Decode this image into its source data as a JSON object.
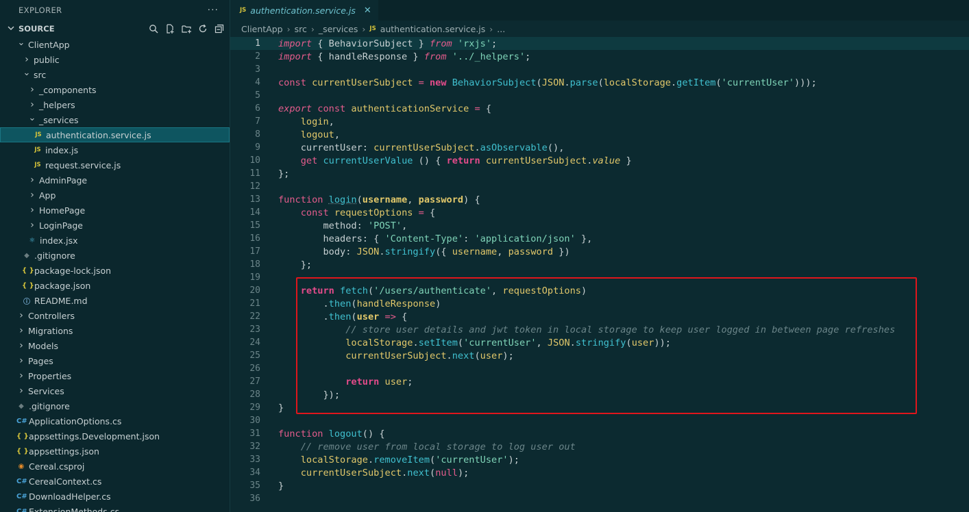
{
  "sidebar": {
    "title": "EXPLORER",
    "more": "···",
    "section": "SOURCE",
    "items": [
      {
        "label": "ClientApp",
        "depth": 1,
        "chev": "⌄",
        "icon": ""
      },
      {
        "label": "public",
        "depth": 2,
        "chev": "›",
        "icon": ""
      },
      {
        "label": "src",
        "depth": 2,
        "chev": "⌄",
        "icon": ""
      },
      {
        "label": "_components",
        "depth": 3,
        "chev": "›",
        "icon": ""
      },
      {
        "label": "_helpers",
        "depth": 3,
        "chev": "›",
        "icon": ""
      },
      {
        "label": "_services",
        "depth": 3,
        "chev": "⌄",
        "icon": ""
      },
      {
        "label": "authentication.service.js",
        "depth": 4,
        "chev": "",
        "icon": "JS",
        "selected": true
      },
      {
        "label": "index.js",
        "depth": 4,
        "chev": "",
        "icon": "JS"
      },
      {
        "label": "request.service.js",
        "depth": 4,
        "chev": "",
        "icon": "JS"
      },
      {
        "label": "AdminPage",
        "depth": 3,
        "chev": "›",
        "icon": ""
      },
      {
        "label": "App",
        "depth": 3,
        "chev": "›",
        "icon": ""
      },
      {
        "label": "HomePage",
        "depth": 3,
        "chev": "›",
        "icon": ""
      },
      {
        "label": "LoginPage",
        "depth": 3,
        "chev": "›",
        "icon": ""
      },
      {
        "label": "index.jsx",
        "depth": 3,
        "chev": "",
        "icon": "react"
      },
      {
        "label": ".gitignore",
        "depth": 2,
        "chev": "",
        "icon": "git"
      },
      {
        "label": "package-lock.json",
        "depth": 2,
        "chev": "",
        "icon": "{}"
      },
      {
        "label": "package.json",
        "depth": 2,
        "chev": "",
        "icon": "{}"
      },
      {
        "label": "README.md",
        "depth": 2,
        "chev": "",
        "icon": "info"
      },
      {
        "label": "Controllers",
        "depth": 1,
        "chev": "›",
        "icon": ""
      },
      {
        "label": "Migrations",
        "depth": 1,
        "chev": "›",
        "icon": ""
      },
      {
        "label": "Models",
        "depth": 1,
        "chev": "›",
        "icon": ""
      },
      {
        "label": "Pages",
        "depth": 1,
        "chev": "›",
        "icon": ""
      },
      {
        "label": "Properties",
        "depth": 1,
        "chev": "›",
        "icon": ""
      },
      {
        "label": "Services",
        "depth": 1,
        "chev": "›",
        "icon": ""
      },
      {
        "label": ".gitignore",
        "depth": 1,
        "chev": "",
        "icon": "git"
      },
      {
        "label": "ApplicationOptions.cs",
        "depth": 1,
        "chev": "",
        "icon": "C#"
      },
      {
        "label": "appsettings.Development.json",
        "depth": 1,
        "chev": "",
        "icon": "{}"
      },
      {
        "label": "appsettings.json",
        "depth": 1,
        "chev": "",
        "icon": "{}"
      },
      {
        "label": "Cereal.csproj",
        "depth": 1,
        "chev": "",
        "icon": "rss"
      },
      {
        "label": "CerealContext.cs",
        "depth": 1,
        "chev": "",
        "icon": "C#"
      },
      {
        "label": "DownloadHelper.cs",
        "depth": 1,
        "chev": "",
        "icon": "C#"
      },
      {
        "label": "ExtensionMethods.cs",
        "depth": 1,
        "chev": "",
        "icon": "C#"
      }
    ]
  },
  "tab": {
    "badge": "JS",
    "label": "authentication.service.js",
    "close": "✕"
  },
  "breadcrumb": [
    "ClientApp",
    "src",
    "_services",
    "authentication.service.js",
    "..."
  ],
  "code": [
    "1",
    "2",
    "3",
    "4",
    "5",
    "6",
    "7",
    "8",
    "9",
    "10",
    "11",
    "12",
    "13",
    "14",
    "15",
    "16",
    "17",
    "18",
    "19",
    "20",
    "21",
    "22",
    "23",
    "24",
    "25",
    "26",
    "27",
    "28",
    "29",
    "30",
    "31",
    "32",
    "33",
    "34",
    "35",
    "36"
  ],
  "colors": {
    "accent": "#e0161c",
    "selected_bg": "#0e5560",
    "editor_bg": "#0c2a30"
  }
}
